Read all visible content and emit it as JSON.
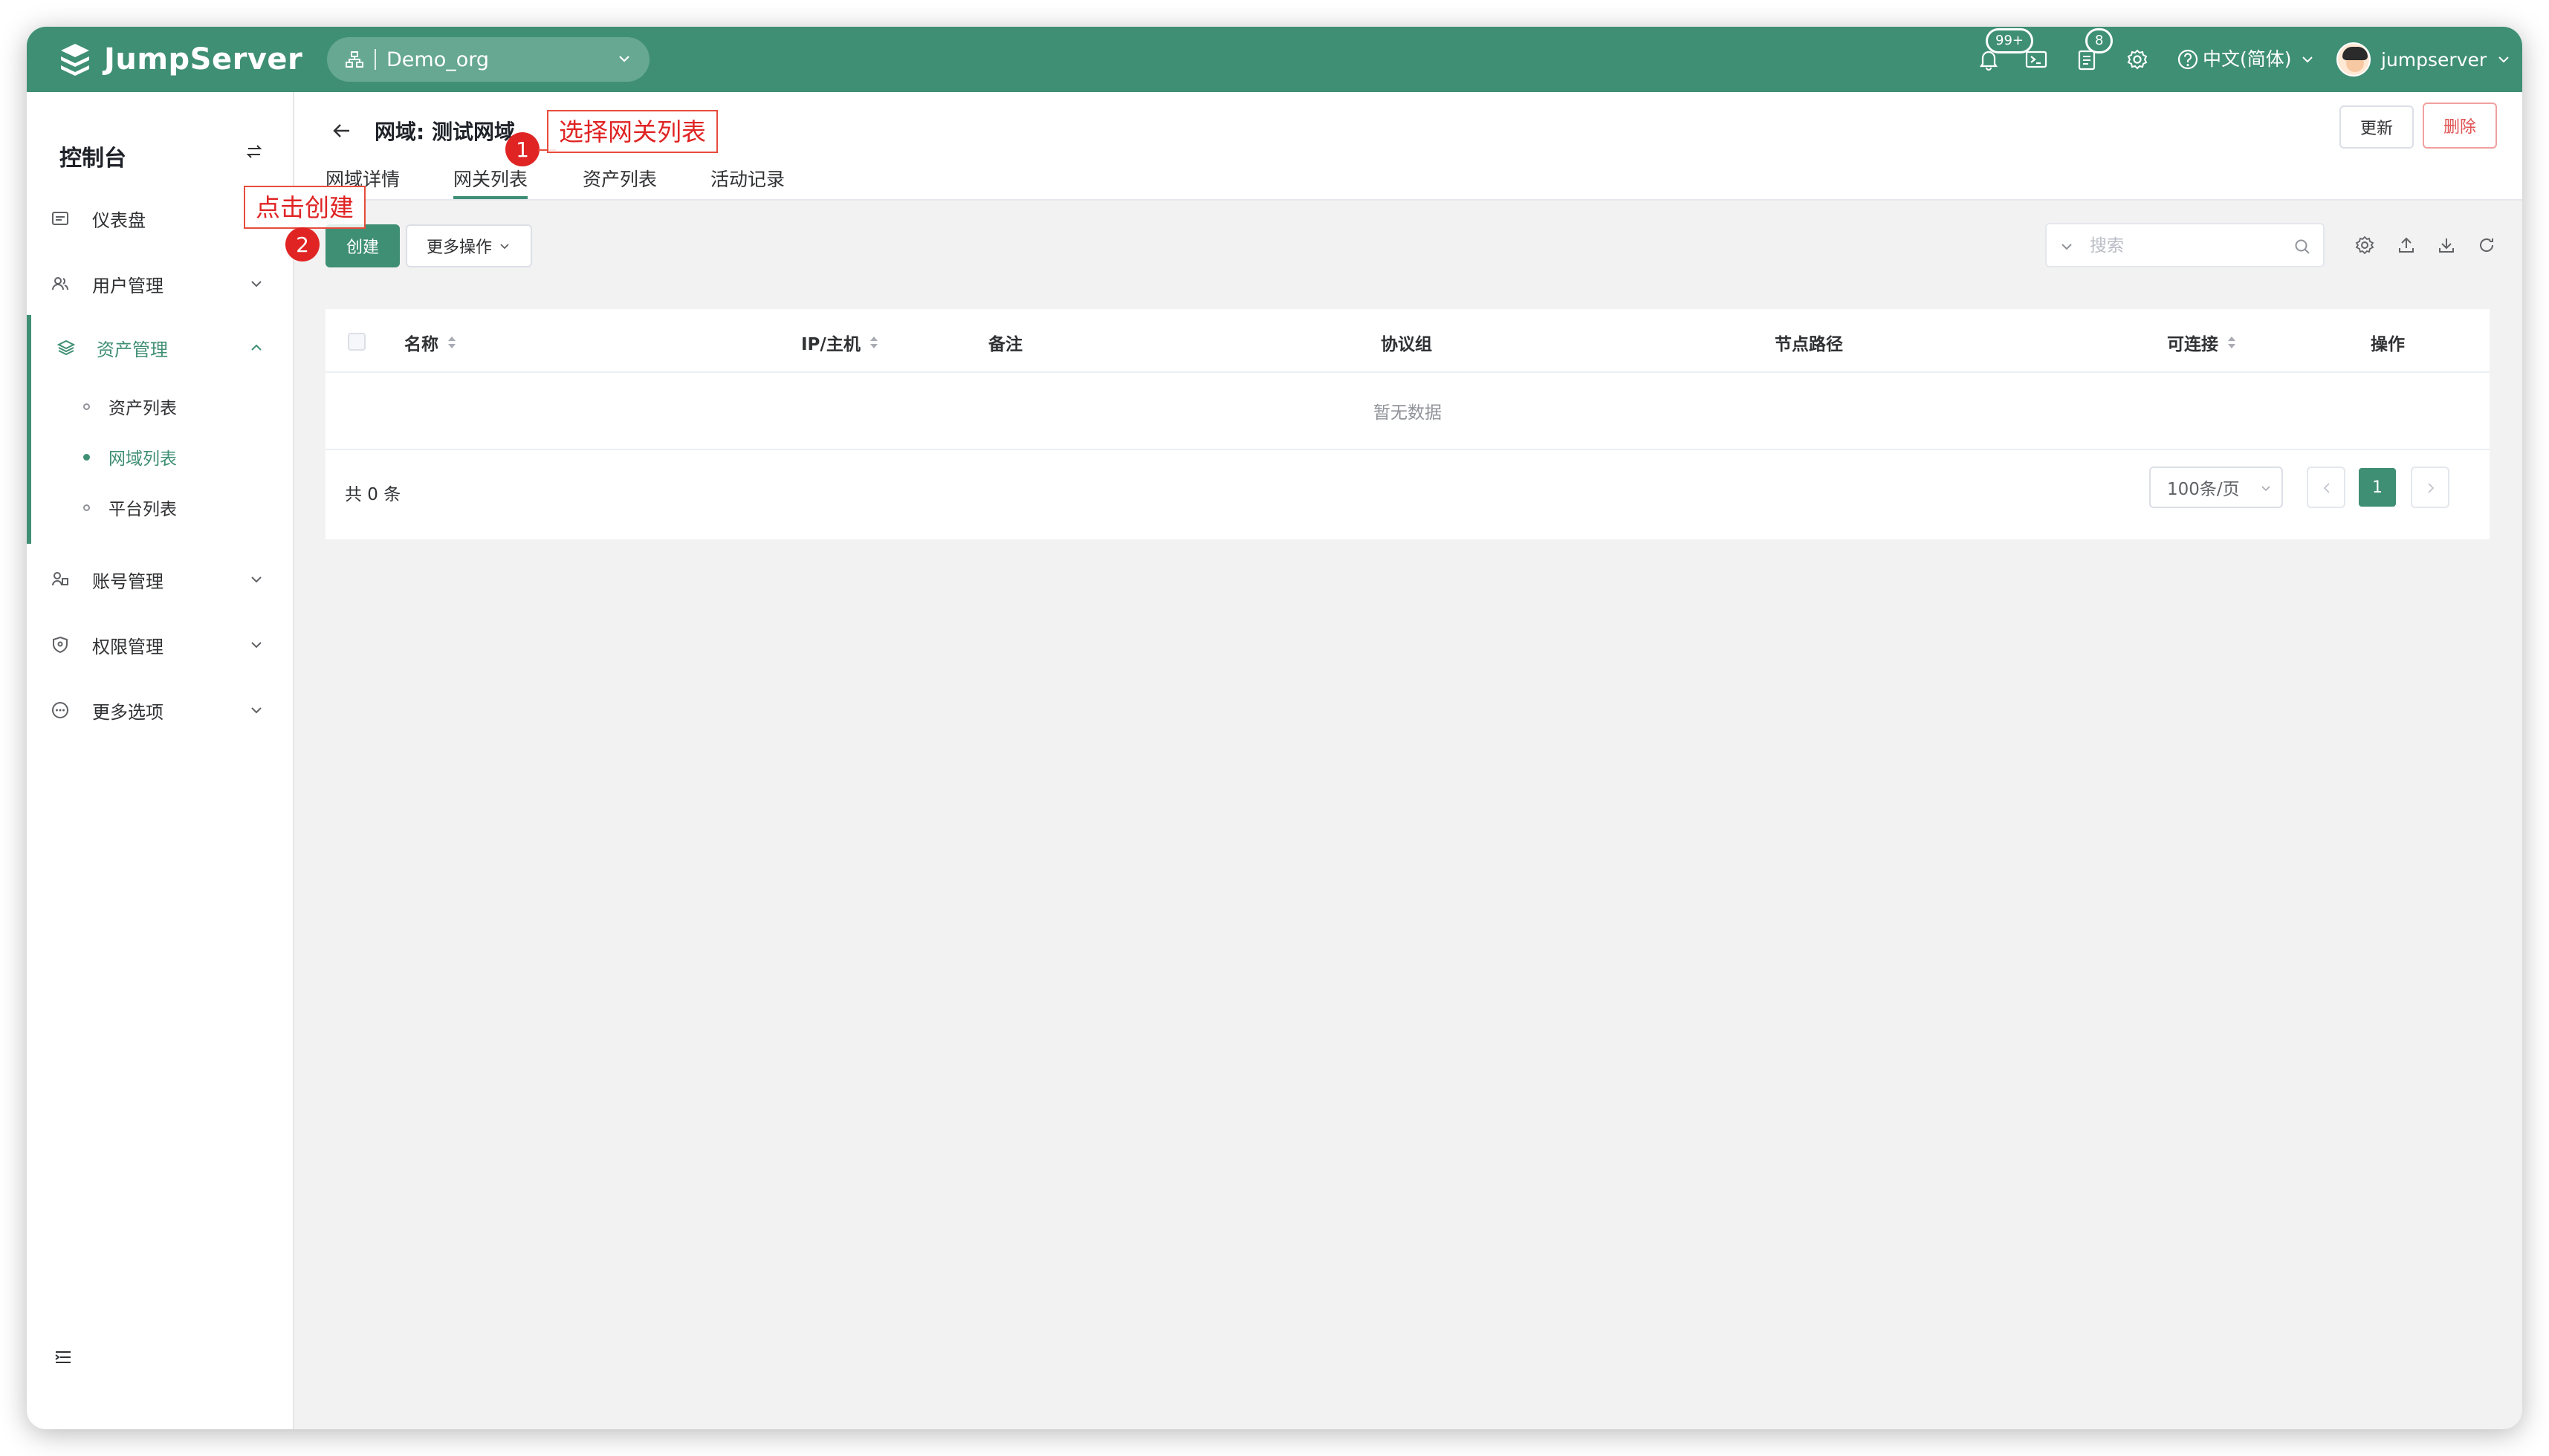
{
  "app": {
    "brand": "JumpServer",
    "org": "Demo_org",
    "language": "中文(简体)",
    "username": "jumpserver"
  },
  "badges": {
    "notifications": "99+",
    "tasks": "8"
  },
  "colors": {
    "primary": "#3f8f74",
    "danger": "#e05050",
    "annotation": "#e02424"
  },
  "sidebar": {
    "title": "控制台",
    "items": [
      {
        "label": "仪表盘",
        "icon": "dashboard-icon"
      },
      {
        "label": "用户管理",
        "icon": "users-icon"
      },
      {
        "label": "资产管理",
        "icon": "layers-icon"
      },
      {
        "label": "账号管理",
        "icon": "account-icon"
      },
      {
        "label": "权限管理",
        "icon": "shield-icon"
      },
      {
        "label": "更多选项",
        "icon": "more-icon"
      }
    ],
    "sub_items": [
      {
        "label": "资产列表"
      },
      {
        "label": "网域列表"
      },
      {
        "label": "平台列表"
      }
    ]
  },
  "page": {
    "title": "网域: 测试网域",
    "tabs": [
      {
        "label": "网域详情"
      },
      {
        "label": "网关列表"
      },
      {
        "label": "资产列表"
      },
      {
        "label": "活动记录"
      }
    ],
    "active_tab": "网关列表",
    "update_label": "更新",
    "delete_label": "删除"
  },
  "toolbar": {
    "create_label": "创建",
    "more_actions_label": "更多操作",
    "search_placeholder": "搜索"
  },
  "table": {
    "columns": [
      "名称",
      "IP/主机",
      "备注",
      "协议组",
      "节点路径",
      "可连接",
      "操作"
    ],
    "sortable": [
      "名称",
      "IP/主机",
      "可连接"
    ],
    "empty_text": "暂无数据",
    "total_text": "共 0 条",
    "page_size": "100条/页",
    "current_page": "1"
  },
  "annotations": [
    {
      "number": "1",
      "text": "选择网关列表"
    },
    {
      "number": "2",
      "text": "点击创建"
    }
  ]
}
